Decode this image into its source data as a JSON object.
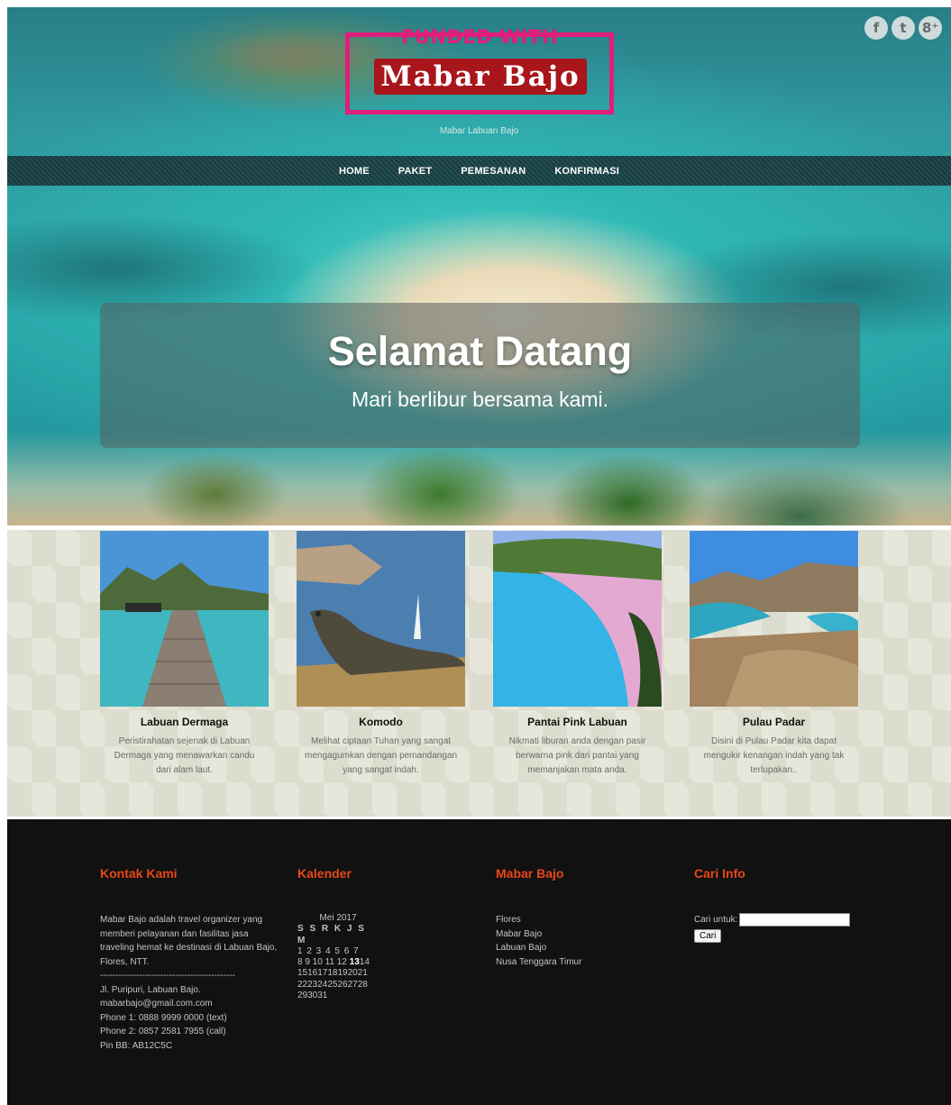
{
  "social": {
    "facebook_glyph": "f",
    "twitter_glyph": "t",
    "google_glyph": "8⁺"
  },
  "logo": {
    "line1": "FUNDED WITH",
    "line2": "Mabar Bajo"
  },
  "tagline": "Mabar Labuan Bajo",
  "nav": {
    "items": [
      "HOME",
      "PAKET",
      "PEMESANAN",
      "KONFIRMASI"
    ]
  },
  "hero": {
    "title": "Selamat Datang",
    "subtitle": "Mari berlibur bersama kami."
  },
  "destinations": [
    {
      "title": "Labuan Dermaga",
      "desc": "Peristirahatan sejenak di Labuan Dermaga yang menawarkan candu dari alam laut."
    },
    {
      "title": "Komodo",
      "desc": "Melihat ciptaan Tuhan yang sangat mengagumkan dengan pemandangan yang sangat indah."
    },
    {
      "title": "Pantai Pink Labuan",
      "desc": "Nikmati liburan anda dengan pasir berwarna pink dari pantai yang memanjakan mata anda."
    },
    {
      "title": "Pulau Padar",
      "desc": "Disini di Pulau Padar kita dapat mengukir kenangan indah yang tak terlupakan.."
    }
  ],
  "footer": {
    "contact": {
      "heading": "Kontak Kami",
      "about": "Mabar Bajo adalah travel organizer yang memberi pelayanan dan fasilitas jasa traveling hemat ke destinasi di Labuan Bajo, Flores, NTT.",
      "divider": "------------------------------------------------",
      "address": "Jl. Puripuri, Labuan Bajo.",
      "email": "mabarbajo@gmail.com.com",
      "phone1": "Phone 1: 0888 9999 0000 (text)",
      "phone2": "Phone 2: 0857 2581 7955 (call)",
      "pin": "Pin BB: AB12C5C"
    },
    "calendar": {
      "heading": "Kalender",
      "month": "Mei 2017",
      "days_header": "S S R K J S M",
      "row1": "1 2 3 4 5 6 7",
      "row2_before": "8 9 10 11 12 ",
      "row2_today": "13",
      "row2_after": "14",
      "row3": "15161718192021",
      "row4": "22232425262728",
      "row5": "293031"
    },
    "links": {
      "heading": "Mabar Bajo",
      "items": [
        "Flores",
        "Mabar Bajo",
        "Labuan Bajo",
        "Nusa Tenggara Timur"
      ]
    },
    "search": {
      "heading": "Cari Info",
      "label": "Cari untuk:",
      "value": "",
      "button": "Cari"
    }
  }
}
